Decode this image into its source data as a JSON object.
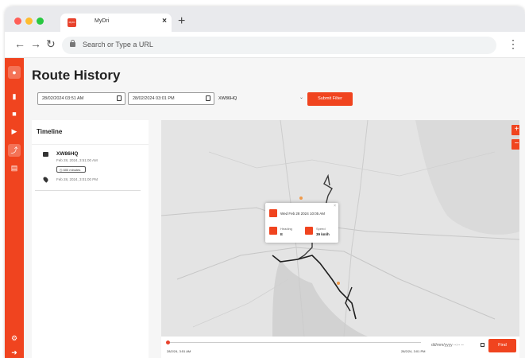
{
  "browser": {
    "tab_title": "MyDri",
    "tab_favicon_text": "MyDri",
    "new_tab": "+",
    "close": "×",
    "url_placeholder": "Search or Type a URL",
    "traffic_light_colors": [
      "#ff5f57",
      "#febc2e",
      "#28c840"
    ]
  },
  "app": {
    "accent_color": "#f0441f",
    "sidebar_icons": [
      "user-icon",
      "bus-icon",
      "building-icon",
      "video-icon",
      "route-icon",
      "document-icon",
      "settings-icon",
      "logout-icon"
    ],
    "page_title": "Route History",
    "filters": {
      "start_datetime": "28/02/2024 03:51 AM",
      "end_datetime": "28/02/2024 03:01 PM",
      "vehicle": "XW86HQ",
      "submit_label": "Submit Filter"
    },
    "timeline": {
      "title": "Timeline",
      "vehicle": "XW86HQ",
      "start_time": "Feb 28, 2024, 3:51:00 AM",
      "duration": "600 minutes",
      "end_time": "Feb 28, 2024, 3:01:00 PM"
    },
    "map": {
      "zoom_in": "+",
      "zoom_out": "−",
      "popup": {
        "datetime": "Wed Feb 28 2024 10:05 AM",
        "heading_label": "Heading",
        "heading_value": "E",
        "speed_label": "Speed",
        "speed_value": "39 km/h",
        "close": "×"
      },
      "player": {
        "start_label": "28/2/24, 3:51 AM",
        "end_label": "28/2/24, 3:01 PM",
        "progress": 0,
        "date_placeholder": "dd/mm/yyyy --:-- --",
        "find_label": "Find"
      }
    }
  }
}
